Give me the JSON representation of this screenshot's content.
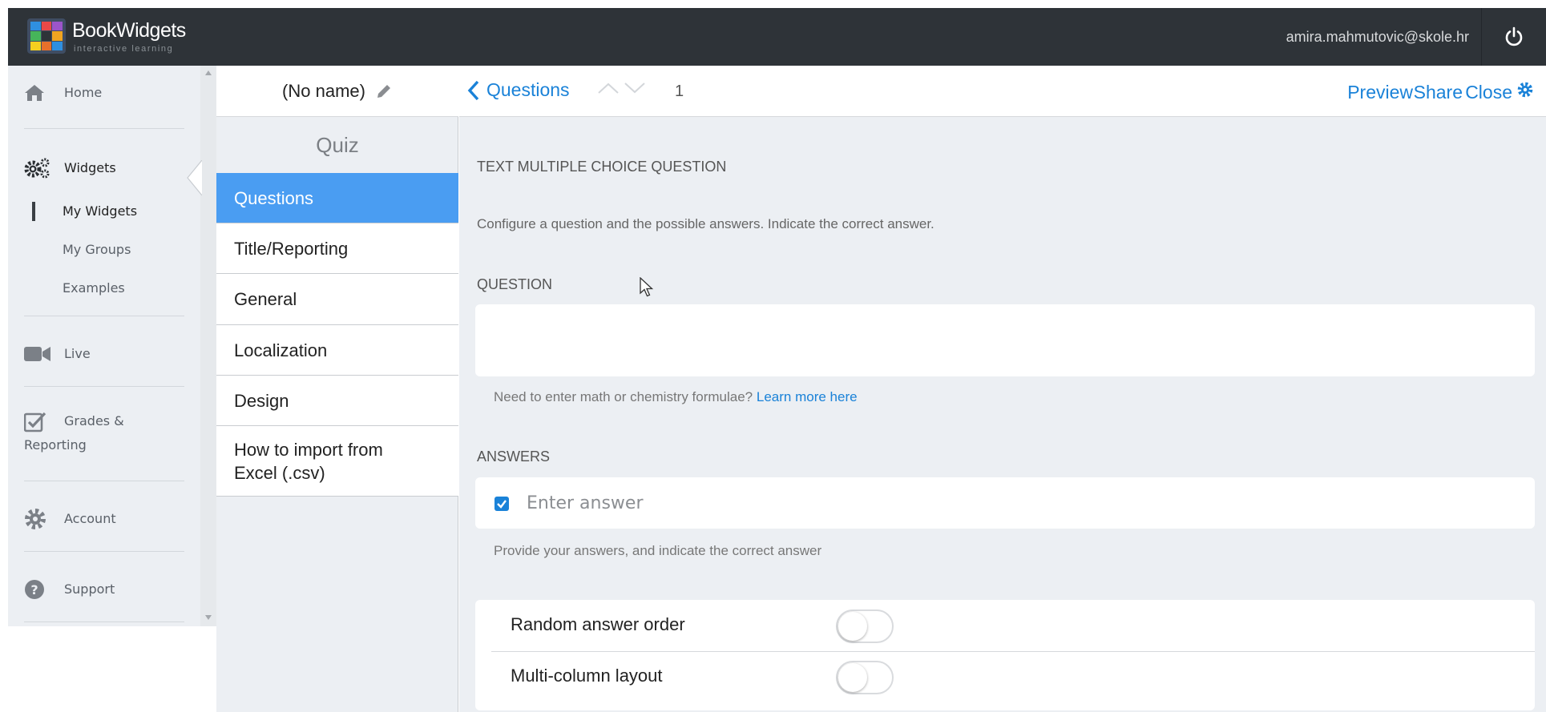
{
  "topbar": {
    "brand": "BookWidgets",
    "tagline": "interactive learning",
    "user_email": "amira.mahmutovic@skole.hr"
  },
  "leftnav": {
    "items": [
      {
        "label": "Home",
        "icon": "home-icon"
      },
      {
        "label": "Widgets",
        "icon": "gears-icon"
      },
      {
        "label": "Live",
        "icon": "video-camera-icon"
      },
      {
        "label": "Grades &",
        "label2": "Reporting",
        "icon": "checkbox-icon"
      },
      {
        "label": "Account",
        "icon": "gear-icon"
      },
      {
        "label": "Support",
        "icon": "question-circle-icon"
      }
    ],
    "widgets_sub": [
      "My Widgets",
      "My Groups",
      "Examples"
    ]
  },
  "midpanel": {
    "widget_name": "(No name)",
    "widget_type": "Quiz",
    "menu": [
      "Questions",
      "Title/Reporting",
      "General",
      "Localization",
      "Design",
      "How to import from Excel (.csv)"
    ],
    "active_index": 0
  },
  "main": {
    "back_label": "Questions",
    "question_number": "1",
    "header_links": {
      "preview": "Preview",
      "share": "Share",
      "close": "Close"
    },
    "question_type": "TEXT MULTIPLE CHOICE QUESTION",
    "description": "Configure a question and the possible answers. Indicate the correct answer.",
    "question_label": "QUESTION",
    "question_value": "",
    "formula_hint": "Need to enter math or chemistry formulae?",
    "formula_link": "Learn more here",
    "answers_label": "ANSWERS",
    "answer_placeholder": "Enter answer",
    "answer_checked": true,
    "answers_hint": "Provide your answers, and indicate the correct answer",
    "options": [
      {
        "label": "Random answer order",
        "on": false
      },
      {
        "label": "Multi-column layout",
        "on": false
      }
    ]
  },
  "colors": {
    "topbar": "#2e3338",
    "accent": "#1a82d8",
    "active_menu": "#4a9df2",
    "panel_bg": "#eceff3"
  }
}
